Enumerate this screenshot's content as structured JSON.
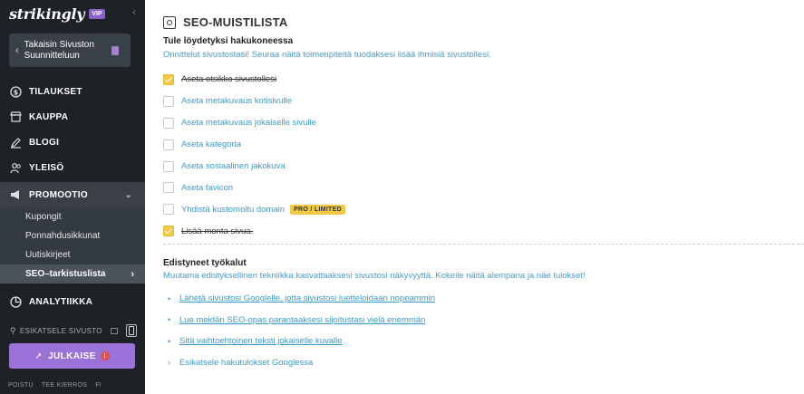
{
  "app": {
    "brand": "strikingly",
    "vip_badge": "VIP"
  },
  "sidebar": {
    "back_label": "Takaisin Sivuston Suunnitteluun",
    "items": [
      {
        "label": "TILAUKSET",
        "icon": "dollar-icon"
      },
      {
        "label": "KAUPPA",
        "icon": "store-icon"
      },
      {
        "label": "BLOGI",
        "icon": "pen-icon"
      },
      {
        "label": "YLEISÖ",
        "icon": "users-icon"
      },
      {
        "label": "PROMOOTIO",
        "icon": "megaphone-icon"
      }
    ],
    "promo_sub": [
      "Kupongit",
      "Ponnahdusikkunat",
      "Uutiskirjeet",
      "SEO–tarkistuslista"
    ],
    "analytics_label": "ANALYTIIKKA",
    "preview_label": "ESIKATSELE SIVUSTO",
    "publish_label": "JULKAISE",
    "publish_alert": "!",
    "footer": [
      "POISTU",
      "TEE KIERROS",
      "FI"
    ]
  },
  "main": {
    "title": "SEO-MUISTILISTA",
    "section1": {
      "heading": "Tule löydetyksi hakukoneessa",
      "description": "Onnittelut sivustostasi! Seuraa näitä toimenpiteitä tuodaksesi lisää ihmisiä sivustollesi."
    },
    "checklist": [
      {
        "label": "Aseta otsikko sivustollesi",
        "checked": true
      },
      {
        "label": "Aseta metakuvaus kotisivulle",
        "checked": false
      },
      {
        "label": "Aseta metakuvaus jokaiselle sivulle",
        "checked": false
      },
      {
        "label": "Aseta kategoria",
        "checked": false
      },
      {
        "label": "Aseta sosiaalinen jakokuva",
        "checked": false
      },
      {
        "label": "Aseta favicon",
        "checked": false
      },
      {
        "label": "Yhdistä kustomoitu domain",
        "checked": false,
        "badge": "PRO / LIMITED"
      },
      {
        "label": "Lisää monta sivua.",
        "checked": true
      }
    ],
    "section2": {
      "heading": "Edistyneet työkalut",
      "description": "Muutama edistyksellinen tekniikka kasvattaaksesi sivustosi näkyvyyttä. Kokeile näitä alempana ja näe tulokset!"
    },
    "links": [
      "Lähetä sivustosi Googlelle, jotta sivustosi luetteloidaan nopeammin",
      "Lue meidän SEO-opas parantaaksesi sijoitustasi vielä enemmän",
      "Sitä vaihtoehtoinen teksti jokaiselle kuvalle",
      "Esikatsele hakutulokset Googlessa"
    ]
  },
  "colors": {
    "sidebar_bg": "#1e2227",
    "accent_purple": "#9b72d8",
    "check_yellow": "#f0c945",
    "link_blue": "#3a9ac4"
  }
}
